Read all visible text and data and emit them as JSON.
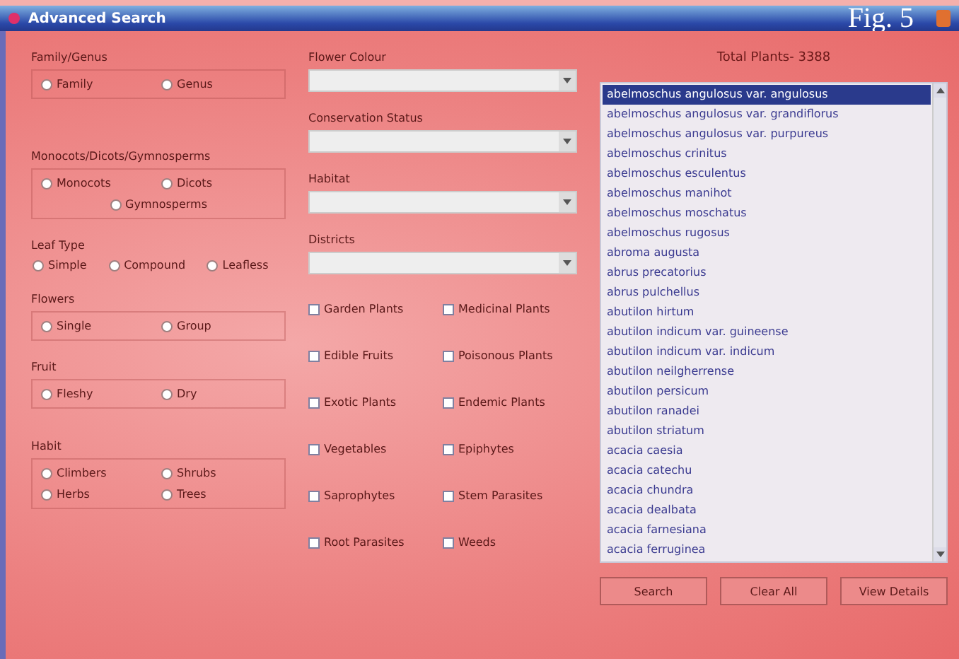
{
  "window": {
    "title": "Advanced Search",
    "figure_label": "Fig. 5"
  },
  "radio_groups": [
    {
      "label": "Family/Genus",
      "kind": "boxed",
      "options": [
        {
          "label": "Family",
          "selected": false
        },
        {
          "label": "Genus",
          "selected": false
        }
      ]
    },
    {
      "label": "Monocots/Dicots/Gymnosperms",
      "kind": "boxed",
      "options": [
        {
          "label": "Monocots",
          "selected": false
        },
        {
          "label": "Dicots",
          "selected": false
        },
        {
          "label": "Gymnosperms",
          "selected": false
        }
      ]
    },
    {
      "label": "Leaf Type",
      "kind": "inline",
      "options": [
        {
          "label": "Simple",
          "selected": false
        },
        {
          "label": "Compound",
          "selected": false
        },
        {
          "label": "Leafless",
          "selected": false
        }
      ]
    },
    {
      "label": "Flowers",
      "kind": "boxed",
      "options": [
        {
          "label": "Single",
          "selected": false
        },
        {
          "label": "Group",
          "selected": false
        }
      ]
    },
    {
      "label": "Fruit",
      "kind": "boxed",
      "options": [
        {
          "label": "Fleshy",
          "selected": false
        },
        {
          "label": "Dry",
          "selected": false
        }
      ]
    },
    {
      "label": "Habit",
      "kind": "boxed",
      "options": [
        {
          "label": "Climbers",
          "selected": false
        },
        {
          "label": "Shrubs",
          "selected": false
        },
        {
          "label": "Herbs",
          "selected": false
        },
        {
          "label": "Trees",
          "selected": false
        }
      ]
    }
  ],
  "dropdowns": [
    {
      "label": "Flower Colour"
    },
    {
      "label": "Conservation Status"
    },
    {
      "label": "Habitat"
    },
    {
      "label": "Districts"
    }
  ],
  "checkboxes": [
    {
      "label": "Garden Plants",
      "checked": false
    },
    {
      "label": "Medicinal Plants",
      "checked": false
    },
    {
      "label": "Edible Fruits",
      "checked": false
    },
    {
      "label": "Poisonous Plants",
      "checked": false
    },
    {
      "label": "Exotic Plants",
      "checked": false
    },
    {
      "label": "Endemic Plants",
      "checked": false
    },
    {
      "label": "Vegetables",
      "checked": false
    },
    {
      "label": "Epiphytes",
      "checked": false
    },
    {
      "label": "Saprophytes",
      "checked": false
    },
    {
      "label": "Stem Parasites",
      "checked": false
    },
    {
      "label": "Root Parasites",
      "checked": false
    },
    {
      "label": "Weeds",
      "checked": false
    }
  ],
  "total_plants": "Total Plants- 3388",
  "plant_list": [
    {
      "name": "abelmoschus angulosus var. angulosus",
      "selected": true
    },
    {
      "name": "abelmoschus angulosus var. grandiflorus",
      "selected": false
    },
    {
      "name": "abelmoschus angulosus var. purpureus",
      "selected": false
    },
    {
      "name": "abelmoschus crinitus",
      "selected": false
    },
    {
      "name": "abelmoschus esculentus",
      "selected": false
    },
    {
      "name": "abelmoschus manihot",
      "selected": false
    },
    {
      "name": "abelmoschus moschatus",
      "selected": false
    },
    {
      "name": "abelmoschus rugosus",
      "selected": false
    },
    {
      "name": "abroma augusta",
      "selected": false
    },
    {
      "name": "abrus precatorius",
      "selected": false
    },
    {
      "name": "abrus pulchellus",
      "selected": false
    },
    {
      "name": "abutilon hirtum",
      "selected": false
    },
    {
      "name": "abutilon indicum var. guineense",
      "selected": false
    },
    {
      "name": "abutilon indicum var. indicum",
      "selected": false
    },
    {
      "name": "abutilon neilgherrense",
      "selected": false
    },
    {
      "name": "abutilon persicum",
      "selected": false
    },
    {
      "name": "abutilon ranadei",
      "selected": false
    },
    {
      "name": "abutilon striatum",
      "selected": false
    },
    {
      "name": "acacia caesia",
      "selected": false
    },
    {
      "name": "acacia catechu",
      "selected": false
    },
    {
      "name": "acacia chundra",
      "selected": false
    },
    {
      "name": "acacia dealbata",
      "selected": false
    },
    {
      "name": "acacia farnesiana",
      "selected": false
    },
    {
      "name": "acacia ferruginea",
      "selected": false
    }
  ],
  "buttons": [
    "Search",
    "Clear All",
    "View Details"
  ]
}
